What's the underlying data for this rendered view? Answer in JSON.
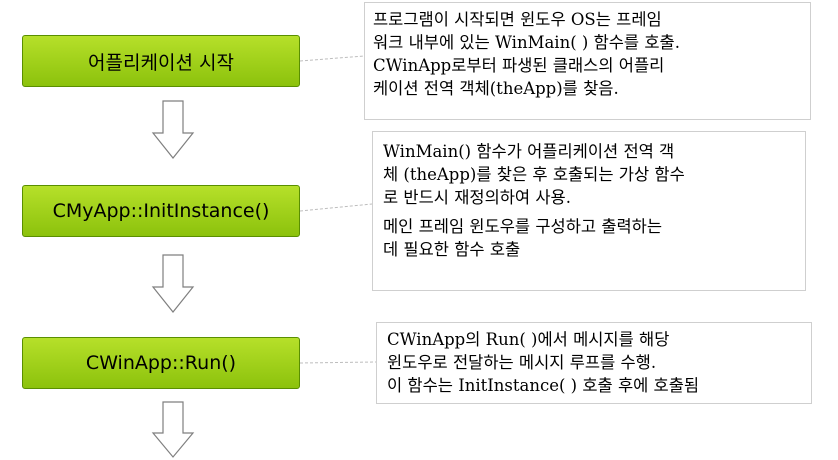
{
  "steps": [
    {
      "label": "어플리케이션 시작"
    },
    {
      "label": "CMyApp::InitInstance()"
    },
    {
      "label": "CWinApp::Run()"
    }
  ],
  "notes": [
    {
      "lines": [
        "프로그램이 시작되면 윈도우 OS는 프레임",
        "워크 내부에 있는 WinMain( ) 함수를 호출.",
        "CWinApp로부터 파생된 클래스의 어플리",
        "케이션 전역 객체(theApp)를 찾음."
      ]
    },
    {
      "lines": [
        "WinMain() 함수가 어플리케이션 전역 객",
        "체 (theApp)를 찾은 후 호출되는 가상 함수",
        "로 반드시 재정의하여 사용."
      ],
      "lines2": [
        "메인 프레임 윈도우를 구성하고 출력하는",
        "데 필요한 함수 호출"
      ]
    },
    {
      "lines": [
        "CWinApp의 Run( )에서  메시지를 해당",
        "윈도우로 전달하는 메시지 루프를 수행.",
        "이 함수는 InitInstance( ) 호출 후에 호출됨"
      ]
    }
  ],
  "colors": {
    "step_fill_top": "#b6e02a",
    "step_fill_bottom": "#8cc20c",
    "step_border": "#5a8f00",
    "connector": "#bdbdbd",
    "arrow_stroke": "#7f7f7f"
  }
}
